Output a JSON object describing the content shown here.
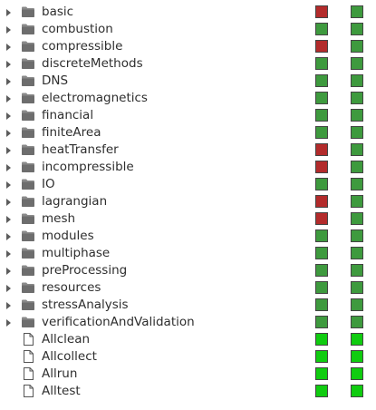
{
  "colors": {
    "folder_fill": "#6d6d6d",
    "folder_tab": "#8a8a8a",
    "red": "#b32b2b",
    "green_dark": "#3e9a3e",
    "green_bright": "#10cc10"
  },
  "tree": {
    "items": [
      {
        "label": "basic",
        "type": "folder",
        "status1": "red",
        "status2": "green_dark"
      },
      {
        "label": "combustion",
        "type": "folder",
        "status1": "green_dark",
        "status2": "green_dark"
      },
      {
        "label": "compressible",
        "type": "folder",
        "status1": "red",
        "status2": "green_dark"
      },
      {
        "label": "discreteMethods",
        "type": "folder",
        "status1": "green_dark",
        "status2": "green_dark"
      },
      {
        "label": "DNS",
        "type": "folder",
        "status1": "green_dark",
        "status2": "green_dark"
      },
      {
        "label": "electromagnetics",
        "type": "folder",
        "status1": "green_dark",
        "status2": "green_dark"
      },
      {
        "label": "financial",
        "type": "folder",
        "status1": "green_dark",
        "status2": "green_dark"
      },
      {
        "label": "finiteArea",
        "type": "folder",
        "status1": "green_dark",
        "status2": "green_dark"
      },
      {
        "label": "heatTransfer",
        "type": "folder",
        "status1": "red",
        "status2": "green_dark"
      },
      {
        "label": "incompressible",
        "type": "folder",
        "status1": "red",
        "status2": "green_dark"
      },
      {
        "label": "IO",
        "type": "folder",
        "status1": "green_dark",
        "status2": "green_dark"
      },
      {
        "label": "lagrangian",
        "type": "folder",
        "status1": "red",
        "status2": "green_dark"
      },
      {
        "label": "mesh",
        "type": "folder",
        "status1": "red",
        "status2": "green_dark"
      },
      {
        "label": "modules",
        "type": "folder",
        "status1": "green_dark",
        "status2": "green_dark"
      },
      {
        "label": "multiphase",
        "type": "folder",
        "status1": "green_dark",
        "status2": "green_dark"
      },
      {
        "label": "preProcessing",
        "type": "folder",
        "status1": "green_dark",
        "status2": "green_dark"
      },
      {
        "label": "resources",
        "type": "folder",
        "status1": "green_dark",
        "status2": "green_dark"
      },
      {
        "label": "stressAnalysis",
        "type": "folder",
        "status1": "green_dark",
        "status2": "green_dark"
      },
      {
        "label": "verificationAndValidation",
        "type": "folder",
        "status1": "green_dark",
        "status2": "green_dark"
      },
      {
        "label": "Allclean",
        "type": "file",
        "status1": "green_bright",
        "status2": "green_bright"
      },
      {
        "label": "Allcollect",
        "type": "file",
        "status1": "green_bright",
        "status2": "green_bright"
      },
      {
        "label": "Allrun",
        "type": "file",
        "status1": "green_bright",
        "status2": "green_bright"
      },
      {
        "label": "Alltest",
        "type": "file",
        "status1": "green_bright",
        "status2": "green_bright"
      }
    ]
  }
}
